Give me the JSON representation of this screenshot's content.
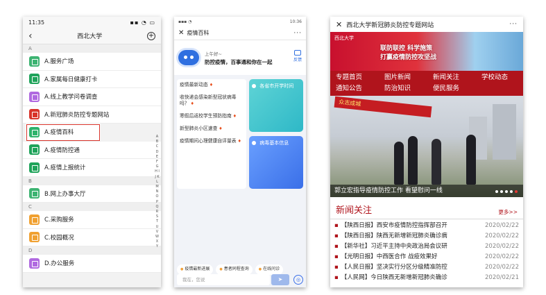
{
  "phone1": {
    "time": "11:35",
    "title": "西北大学",
    "sections": [
      {
        "letter": "A",
        "items": [
          {
            "label": "A.服务广场",
            "color": "#3cb371"
          },
          {
            "label": "A.家属每日健康打卡",
            "color": "#1fa35a"
          },
          {
            "label": "A.线上教学问卷调查",
            "color": "#b069e0"
          },
          {
            "label": "A.新冠肺炎防控专题网站",
            "color": "#d8332a"
          },
          {
            "label": "A.疫情百科",
            "color": "#2db36b"
          },
          {
            "label": "A.疫情防控通",
            "color": "#1fa35a"
          },
          {
            "label": "A.疫情上报统计",
            "color": "#1fa35a"
          }
        ]
      },
      {
        "letter": "B",
        "items": [
          {
            "label": "B.网上办事大厅",
            "color": "#3cb371"
          }
        ]
      },
      {
        "letter": "C",
        "items": [
          {
            "label": "C.采购服务",
            "color": "#f0a030"
          },
          {
            "label": "C.校园概况",
            "color": "#f0a030"
          }
        ]
      },
      {
        "letter": "D",
        "items": [
          {
            "label": "D.办公服务",
            "color": "#b069e0"
          }
        ]
      }
    ],
    "index_letters": "A B C D E F G H I J K L M N O P Q R S T U V W X Y"
  },
  "phone2": {
    "time": "10:36",
    "title": "疫情百科",
    "greet_line1": "上午好~",
    "greet_line2": "防控疫情，百事通和你在一起",
    "feedback": "反馈",
    "links": [
      "疫情最新动态",
      "收快递会感染新型冠状病毒吗？",
      "寒假后返校学生预防指南",
      "新型肺炎小区速查",
      "疫情期间心理健康自评量表"
    ],
    "tiles": [
      "各省市开学时间",
      "病毒基本信息"
    ],
    "chips": [
      "疫情最新进展",
      "患者同程查询",
      "在线问诊"
    ],
    "input_placeholder": "我在，您说"
  },
  "phone3": {
    "title": "西北大学新冠肺炎防控专题网站",
    "banner_logo": "西北大学",
    "banner_slogan_1": "联防联控  科学施策",
    "banner_slogan_2": "打赢疫情防控攻坚战",
    "menu": [
      "专题首页",
      "图片新闻",
      "新闻关注",
      "学校动态",
      "通知公告",
      "防治知识",
      "便民服务"
    ],
    "photo_banner": "众志成城",
    "photo_caption": "郭立宏指导疫情防控工作 看望慰问一线",
    "news_title": "新闻关注",
    "news_more": "更多>>",
    "news": [
      {
        "title": "【陕西日报】西安市疫情防控指挥部召开",
        "date": "2020/02/22"
      },
      {
        "title": "【陕西日报】陕西无新增新冠肺炎确诊病",
        "date": "2020/02/22"
      },
      {
        "title": "【新华社】习近平主持中央政治局会议研",
        "date": "2020/02/22"
      },
      {
        "title": "【光明日报】中西医合作 战疫效果好",
        "date": "2020/02/22"
      },
      {
        "title": "【人民日报】坚决实行分区分级精准防控",
        "date": "2020/02/22"
      },
      {
        "title": "【人民网】今日陕西无新增新冠肺炎确诊",
        "date": "2020/02/21"
      }
    ]
  }
}
